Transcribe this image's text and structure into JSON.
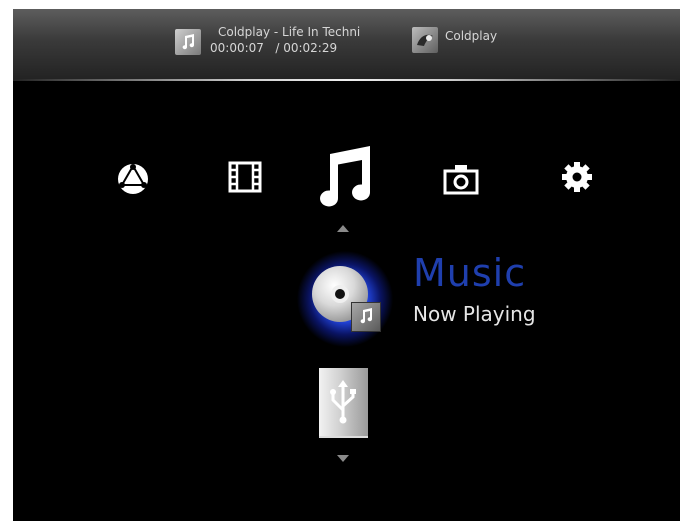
{
  "now_playing": {
    "thumb_icon": "music-note-icon",
    "title": "Coldplay - Life In Techni",
    "elapsed": "00:00:07",
    "total": "/ 00:02:29",
    "artist_icon": "album-art-icon",
    "artist": "Coldplay"
  },
  "categories": [
    {
      "name": "network",
      "icon": "network-globe-icon"
    },
    {
      "name": "movies",
      "icon": "film-strip-icon"
    },
    {
      "name": "music",
      "icon": "music-note-icon",
      "selected": true
    },
    {
      "name": "photos",
      "icon": "camera-icon"
    },
    {
      "name": "settings",
      "icon": "gear-icon"
    }
  ],
  "selected": {
    "title": "Music",
    "subtitle": "Now Playing",
    "title_color": "#1f3fae"
  },
  "sources": [
    {
      "icon": "disc-icon",
      "selected": true
    },
    {
      "icon": "usb-icon",
      "selected": false
    }
  ]
}
